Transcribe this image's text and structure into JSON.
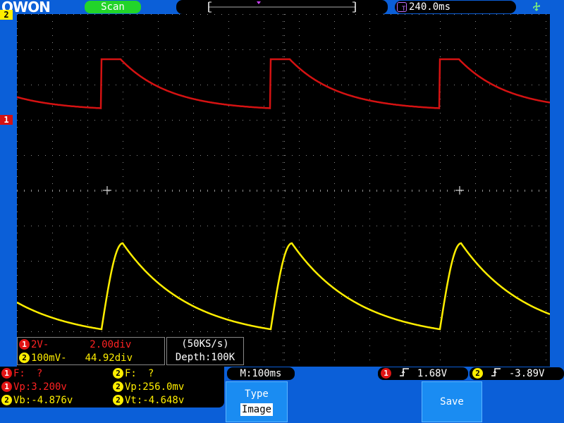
{
  "header": {
    "logo": "OWON",
    "run_state": "Scan",
    "timebase_offset": "240.0ms"
  },
  "screen": {
    "ch2_marker": "2",
    "ch1_marker": "1"
  },
  "scale": {
    "ch1_badge": "1",
    "ch1_volts": "2V-",
    "ch1_div": "2.00div",
    "ch2_badge": "2",
    "ch2_volts": "100mV-",
    "ch2_div": "44.92div",
    "sample_rate": "(50KS/s)",
    "depth": "Depth:100K"
  },
  "measurements": {
    "ch1_freq_label": "F:",
    "ch1_freq_value": "?",
    "ch1_vp": "Vp:3.200v",
    "ch1_vb": "Vb:-4.876v",
    "ch2_freq_label": "F:",
    "ch2_freq_value": "?",
    "ch2_vp": "Vp:256.0mv",
    "ch2_vt": "Vt:-4.648v"
  },
  "status": {
    "main_timebase": "M:100ms",
    "ch1_trigger_level": "1.68V",
    "ch2_trigger_level": "-3.89V"
  },
  "menu": {
    "type_label": "Type",
    "type_value": "Image",
    "save_label": "Save"
  },
  "colors": {
    "ch1": "#d51212",
    "ch2": "#ffee00",
    "frame": "#0b5fd8",
    "run_state": "#22d42a"
  }
}
